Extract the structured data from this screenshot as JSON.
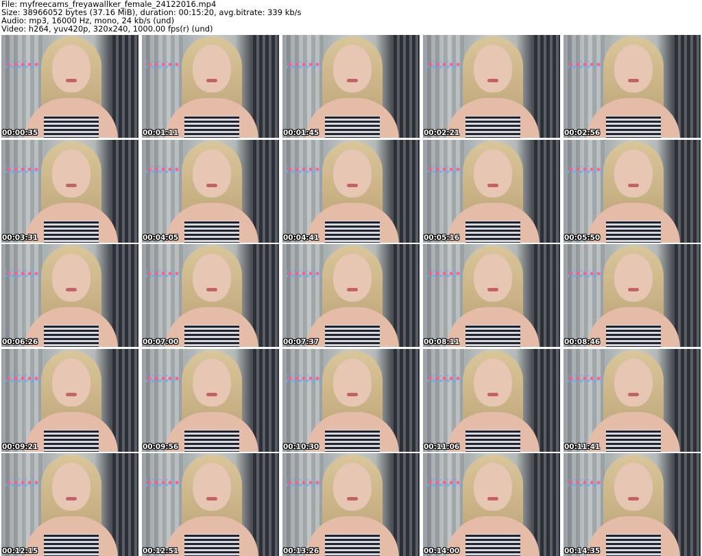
{
  "header": {
    "file_line": "File: myfreecams_freyawallker_female_24122016.mp4",
    "size_line": "Size: 38966052 bytes (37.16 MiB), duration: 00:15:20, avg.bitrate: 339 kb/s",
    "audio_line": "Audio: mp3, 16000 Hz, mono, 24 kb/s (und)",
    "video_line": "Video: h264, yuv420p, 320x240, 1000.00 fps(r) (und)"
  },
  "thumbnails": [
    {
      "timestamp": "00:00:35",
      "content": "video-frame"
    },
    {
      "timestamp": "00:01:11",
      "content": "video-frame"
    },
    {
      "timestamp": "00:01:45",
      "content": "video-frame"
    },
    {
      "timestamp": "00:02:21",
      "content": "video-frame"
    },
    {
      "timestamp": "00:02:56",
      "content": "video-frame"
    },
    {
      "timestamp": "00:03:31",
      "content": "video-frame"
    },
    {
      "timestamp": "00:04:05",
      "content": "video-frame"
    },
    {
      "timestamp": "00:04:41",
      "content": "video-frame"
    },
    {
      "timestamp": "00:05:16",
      "content": "video-frame"
    },
    {
      "timestamp": "00:05:50",
      "content": "video-frame"
    },
    {
      "timestamp": "00:06:26",
      "content": "video-frame"
    },
    {
      "timestamp": "00:07:00",
      "content": "video-frame"
    },
    {
      "timestamp": "00:07:37",
      "content": "video-frame"
    },
    {
      "timestamp": "00:08:11",
      "content": "video-frame"
    },
    {
      "timestamp": "00:08:46",
      "content": "video-frame"
    },
    {
      "timestamp": "00:09:21",
      "content": "video-frame"
    },
    {
      "timestamp": "00:09:56",
      "content": "video-frame"
    },
    {
      "timestamp": "00:10:30",
      "content": "video-frame"
    },
    {
      "timestamp": "00:11:06",
      "content": "video-frame"
    },
    {
      "timestamp": "00:11:41",
      "content": "video-frame"
    },
    {
      "timestamp": "00:12:15",
      "content": "video-frame"
    },
    {
      "timestamp": "00:12:51",
      "content": "video-frame"
    },
    {
      "timestamp": "00:13:26",
      "content": "video-frame"
    },
    {
      "timestamp": "00:14:00",
      "content": "video-frame"
    },
    {
      "timestamp": "00:14:35",
      "content": "video-frame"
    }
  ]
}
